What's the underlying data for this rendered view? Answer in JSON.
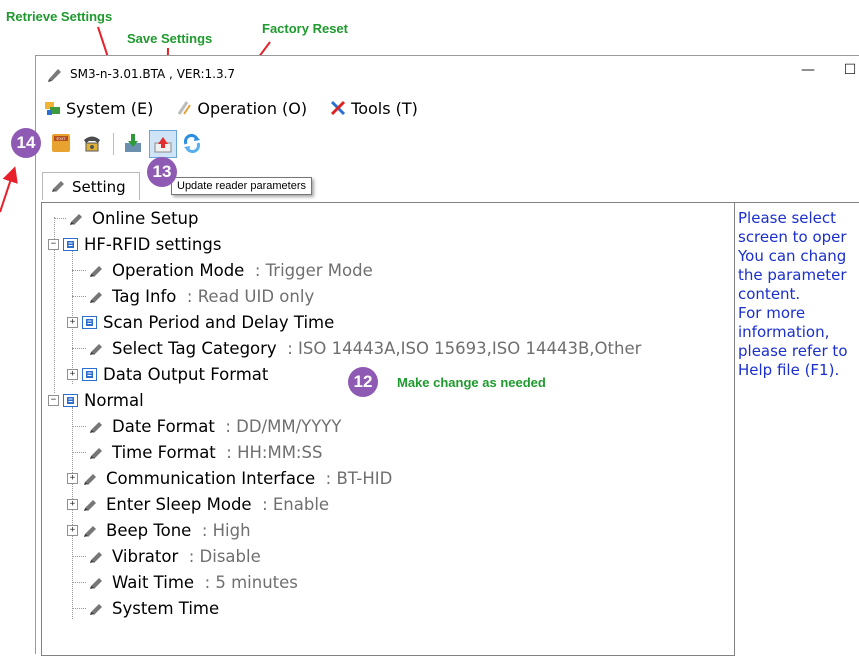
{
  "annotations": {
    "retrieve_settings": "Retrieve Settings",
    "save_settings": "Save Settings",
    "factory_reset": "Factory Reset",
    "make_change": "Make change as needed",
    "badge_12": "12",
    "badge_13": "13",
    "badge_14": "14"
  },
  "window": {
    "title": "SM3-n-3.01.BTA , VER:1.3.7",
    "minimize": "—",
    "maximize": "☐"
  },
  "menu": {
    "system": "System (E)",
    "operation": "Operation (O)",
    "tools": "Tools (T)"
  },
  "tooltip": "Update reader parameters",
  "tab": {
    "label": "Setting"
  },
  "tree": {
    "online_setup": "Online Setup",
    "hf_rfid": "HF-RFID settings",
    "operation_mode": {
      "label": "Operation Mode",
      "value": ": Trigger Mode"
    },
    "tag_info": {
      "label": "Tag Info",
      "value": ": Read UID only"
    },
    "scan_period": "Scan Period and Delay Time",
    "select_tag": {
      "label": "Select Tag Category",
      "value": ": ISO 14443A,ISO 15693,ISO 14443B,Other"
    },
    "data_output": "Data Output Format",
    "normal": "Normal",
    "date_format": {
      "label": "Date Format",
      "value": ": DD/MM/YYYY"
    },
    "time_format": {
      "label": "Time Format",
      "value": ": HH:MM:SS"
    },
    "comm_interface": {
      "label": "Communication Interface",
      "value": ": BT-HID"
    },
    "sleep_mode": {
      "label": "Enter Sleep Mode",
      "value": ": Enable"
    },
    "beep_tone": {
      "label": "Beep Tone",
      "value": ": High"
    },
    "vibrator": {
      "label": "Vibrator",
      "value": ": Disable"
    },
    "wait_time": {
      "label": "Wait Time",
      "value": ": 5 minutes"
    },
    "system_time": "System Time"
  },
  "help": {
    "lines": [
      "Please select",
      "screen to oper",
      "You can chang",
      "the parameter",
      "content.",
      "For more",
      "information,",
      "please refer to",
      "Help file (F1)."
    ]
  },
  "colors": {
    "annotation_green": "#1f9a2e",
    "badge_purple": "#8e5ab3",
    "arrow_red": "#e8202a",
    "help_blue": "#1a2fcc",
    "value_gray": "#6f6f6f"
  }
}
